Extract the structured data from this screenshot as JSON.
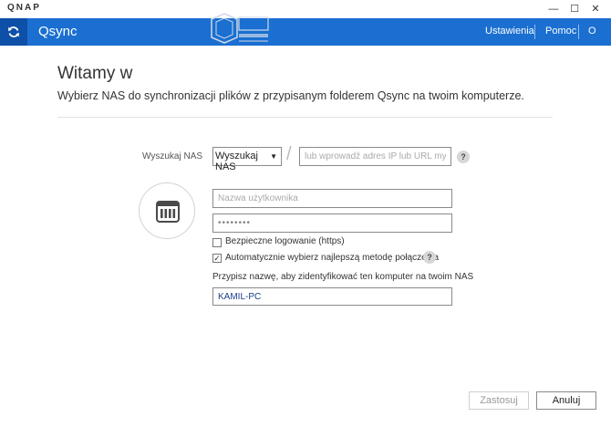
{
  "window": {
    "brand": "QNAP",
    "minimize": "—",
    "maximize": "☐",
    "close": "✕"
  },
  "toolbar": {
    "app_name": "Qsync",
    "nav": {
      "ustawienia": "Ustawienia",
      "pomoc": "Pomoc",
      "user": "O"
    },
    "accent_color": "#1a6fd1"
  },
  "main": {
    "welcome": "Witamy w",
    "subtitle": "Wybierz NAS do synchronizacji plików z przypisanym folderem Qsync na twoim komputerze.",
    "search_label": "Wyszukaj NAS",
    "search_select": "Wyszukaj NAS",
    "slash": "/",
    "ip_placeholder": "lub wprowadź adres IP lub URL myQNAPcloud",
    "help_glyph": "?",
    "username_placeholder": "Nazwa użytkownika",
    "password_value": "••••••••",
    "secure_login_label": "Bezpieczne logowanie (https)",
    "secure_login_checked": false,
    "auto_connect_label": "Automatycznie wybierz najlepszą metodę połączenia",
    "auto_connect_checked": true,
    "checkmark": "✓",
    "pc_name_label": "Przypisz nazwę, aby zidentyfikować ten komputer na twoim NAS",
    "pc_name_value": "KAMIL-PC"
  },
  "footer": {
    "apply": "Zastosuj",
    "cancel": "Anuluj"
  }
}
